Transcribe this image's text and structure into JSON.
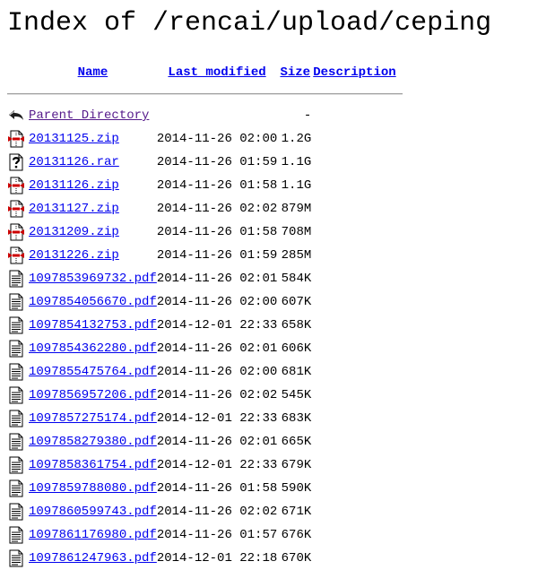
{
  "page": {
    "title": "Index of /rencai/upload/ceping"
  },
  "columns": {
    "name": "Name",
    "last_modified": "Last modified",
    "size": "Size",
    "description": "Description"
  },
  "parent": {
    "label": "Parent Directory",
    "size": "-",
    "icon": "back-arrow-icon"
  },
  "files": [
    {
      "name": "20131125.zip",
      "modified": "2014-11-26 02:00",
      "size": "1.2G",
      "icon": "compressed-file-icon"
    },
    {
      "name": "20131126.rar",
      "modified": "2014-11-26 01:59",
      "size": "1.1G",
      "icon": "unknown-file-icon"
    },
    {
      "name": "20131126.zip",
      "modified": "2014-11-26 01:58",
      "size": "1.1G",
      "icon": "compressed-file-icon"
    },
    {
      "name": "20131127.zip",
      "modified": "2014-11-26 02:02",
      "size": "879M",
      "icon": "compressed-file-icon"
    },
    {
      "name": "20131209.zip",
      "modified": "2014-11-26 01:58",
      "size": "708M",
      "icon": "compressed-file-icon"
    },
    {
      "name": "20131226.zip",
      "modified": "2014-11-26 01:59",
      "size": "285M",
      "icon": "compressed-file-icon"
    },
    {
      "name": "1097853969732.pdf",
      "modified": "2014-11-26 02:01",
      "size": "584K",
      "icon": "text-file-icon"
    },
    {
      "name": "1097854056670.pdf",
      "modified": "2014-11-26 02:00",
      "size": "607K",
      "icon": "text-file-icon"
    },
    {
      "name": "1097854132753.pdf",
      "modified": "2014-12-01 22:33",
      "size": "658K",
      "icon": "text-file-icon"
    },
    {
      "name": "1097854362280.pdf",
      "modified": "2014-11-26 02:01",
      "size": "606K",
      "icon": "text-file-icon"
    },
    {
      "name": "1097855475764.pdf",
      "modified": "2014-11-26 02:00",
      "size": "681K",
      "icon": "text-file-icon"
    },
    {
      "name": "1097856957206.pdf",
      "modified": "2014-11-26 02:02",
      "size": "545K",
      "icon": "text-file-icon"
    },
    {
      "name": "1097857275174.pdf",
      "modified": "2014-12-01 22:33",
      "size": "683K",
      "icon": "text-file-icon"
    },
    {
      "name": "1097858279380.pdf",
      "modified": "2014-11-26 02:01",
      "size": "665K",
      "icon": "text-file-icon"
    },
    {
      "name": "1097858361754.pdf",
      "modified": "2014-12-01 22:33",
      "size": "679K",
      "icon": "text-file-icon"
    },
    {
      "name": "1097859788080.pdf",
      "modified": "2014-11-26 01:58",
      "size": "590K",
      "icon": "text-file-icon"
    },
    {
      "name": "1097860599743.pdf",
      "modified": "2014-11-26 02:02",
      "size": "671K",
      "icon": "text-file-icon"
    },
    {
      "name": "1097861176980.pdf",
      "modified": "2014-11-26 01:57",
      "size": "676K",
      "icon": "text-file-icon"
    },
    {
      "name": "1097861247963.pdf",
      "modified": "2014-12-01 22:18",
      "size": "670K",
      "icon": "text-file-icon"
    }
  ],
  "colors": {
    "link": "#0000ee",
    "visited_link": "#551a8b",
    "rule": "#a0a0a0"
  }
}
